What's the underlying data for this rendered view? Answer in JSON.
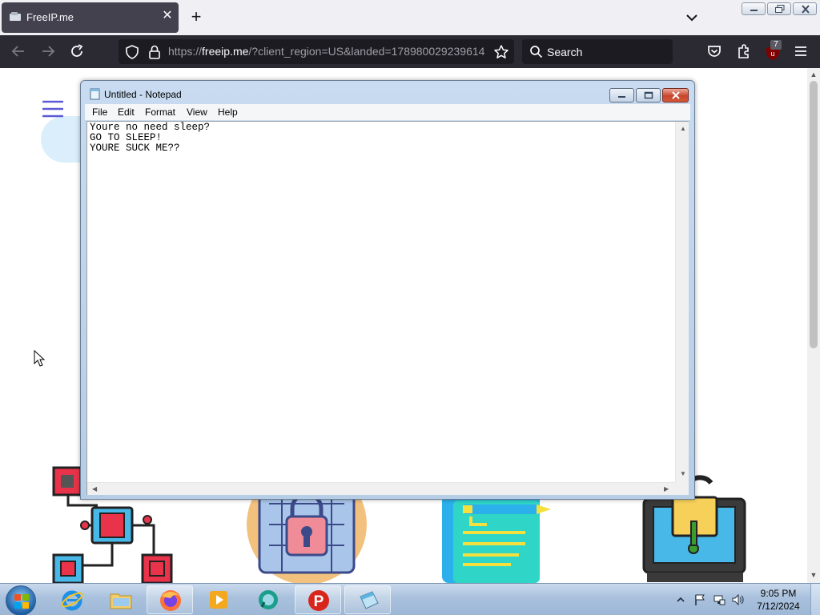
{
  "browser": {
    "tab": {
      "title": "FreeIP.me",
      "close_glyph": "✕"
    },
    "new_tab_glyph": "+",
    "url": {
      "prefix": "https://",
      "host": "freeip.me",
      "rest": "/?client_region=US&landed=178980029239614"
    },
    "search": {
      "placeholder": "Search"
    },
    "extension_badge": "7",
    "colors": {
      "tab_bg": "#42414d",
      "toolbar_bg": "#2b2a33",
      "urlbar_bg": "#1c1b22",
      "tabstrip_bg": "#f0f0f4"
    }
  },
  "notepad": {
    "title": "Untitled - Notepad",
    "menu": [
      "File",
      "Edit",
      "Format",
      "View",
      "Help"
    ],
    "content": "Youre no need sleep?\nGO TO SLEEP!\nYOURE SUCK ME??"
  },
  "taskbar": {
    "items": [
      "start-orb",
      "internet-explorer",
      "windows-explorer",
      "firefox",
      "media-player",
      "messenger",
      "psiphon",
      "notepad"
    ],
    "clock": {
      "time": "9:05 PM",
      "date": "7/12/2024"
    }
  }
}
